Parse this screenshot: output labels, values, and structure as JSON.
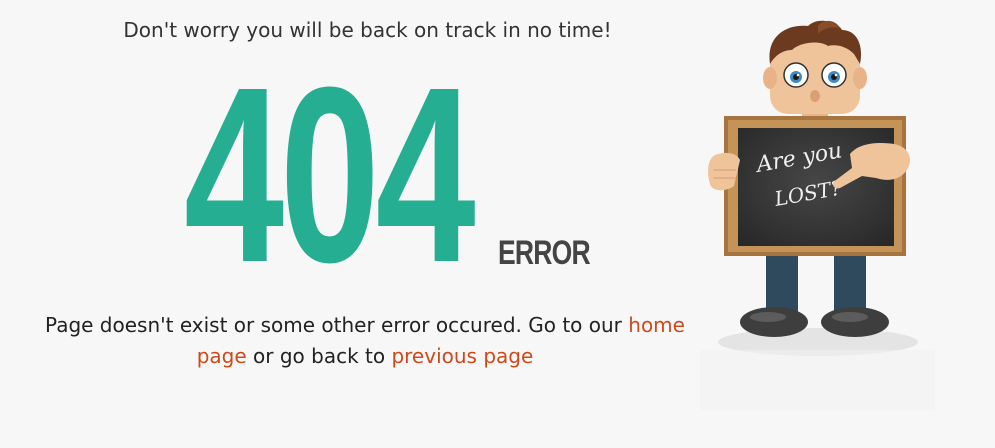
{
  "tagline": "Don't worry you will be back on track in no time!",
  "error": {
    "code": "404",
    "label": "ERROR"
  },
  "message": {
    "before_home": "Page doesn't exist or some other error occured. Go to our ",
    "home_link": "home page",
    "middle": " or go back to ",
    "previous_link": "previous page"
  },
  "character": {
    "chalkboard_line1": "Are you",
    "chalkboard_line2": "LOST?"
  },
  "colors": {
    "accent_teal": "#26ae92",
    "link_orange": "#cc4a1c",
    "background": "#f7f7f7"
  }
}
